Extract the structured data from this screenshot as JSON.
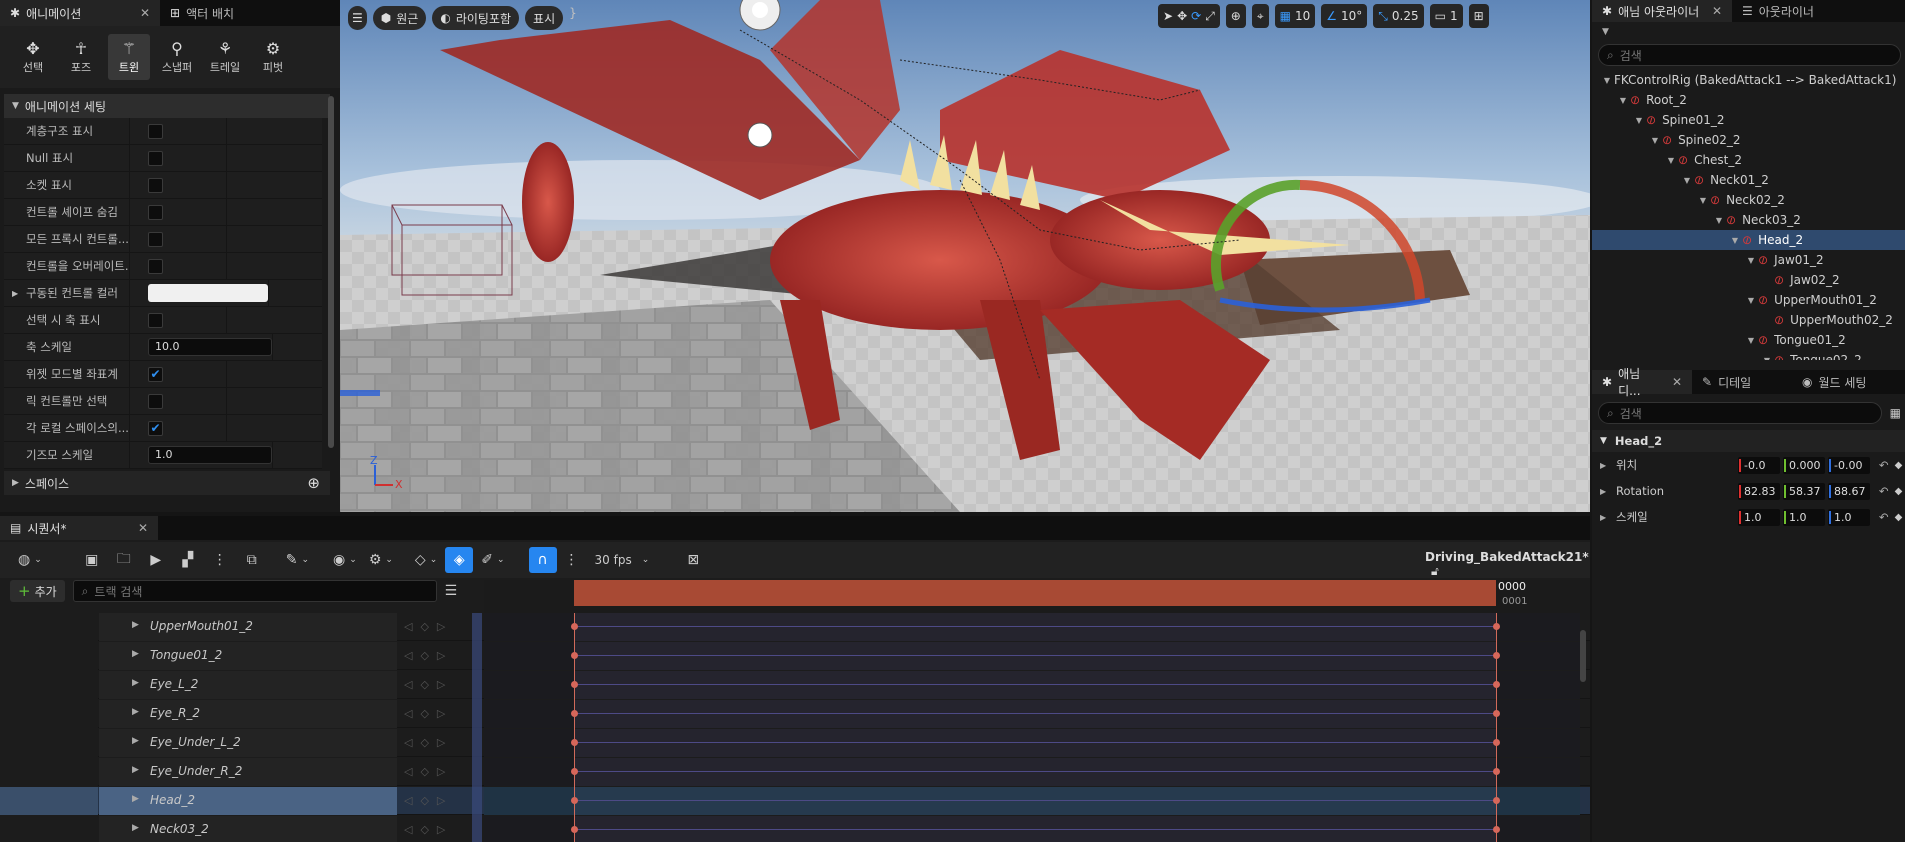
{
  "left_panel": {
    "tabs": [
      {
        "label": "애니메이션",
        "active": true
      },
      {
        "label": "액터 배치",
        "active": false
      }
    ],
    "modes": [
      {
        "label": "선택",
        "icon": "select-icon"
      },
      {
        "label": "포즈",
        "icon": "pose-icon"
      },
      {
        "label": "트윈",
        "icon": "tween-icon",
        "selected": true
      },
      {
        "label": "스냅퍼",
        "icon": "snapper-icon"
      },
      {
        "label": "트레일",
        "icon": "trail-icon"
      },
      {
        "label": "피벗",
        "icon": "pivot-icon"
      }
    ],
    "section_title": "애니메이션 세팅",
    "rows": [
      {
        "label": "계층구조 표시",
        "type": "checkbox",
        "checked": false
      },
      {
        "label": "Null 표시",
        "type": "checkbox",
        "checked": false
      },
      {
        "label": "소켓 표시",
        "type": "checkbox",
        "checked": false
      },
      {
        "label": "컨트롤 셰이프 숨김",
        "type": "checkbox",
        "checked": false
      },
      {
        "label": "모든 프록시 컨트롤...",
        "type": "checkbox",
        "checked": false
      },
      {
        "label": "컨트롤을 오버레이트...",
        "type": "checkbox",
        "checked": false
      },
      {
        "label": "구동된 컨트롤 컬러",
        "type": "color",
        "expandable": true
      },
      {
        "label": "선택 시 축 표시",
        "type": "checkbox",
        "checked": false
      },
      {
        "label": "축 스케일",
        "type": "number",
        "value": "10.0"
      },
      {
        "label": "위젯 모드별 좌표계",
        "type": "checkbox",
        "checked": true
      },
      {
        "label": "릭 컨트롤만 선택",
        "type": "checkbox",
        "checked": false
      },
      {
        "label": "각 로컬 스페이스의...",
        "type": "checkbox",
        "checked": true
      },
      {
        "label": "기즈모 스케일",
        "type": "number",
        "value": "1.0"
      }
    ],
    "space_section": "스페이스"
  },
  "viewport": {
    "view_mode": "원근",
    "lighting": "라이팅포함",
    "show": "표시",
    "grid_snap": "10",
    "rot_snap": "10°",
    "scale_snap": "0.25",
    "camera_speed": "1"
  },
  "outliner": {
    "tabs": [
      {
        "label": "애님 아웃라이너",
        "active": true
      },
      {
        "label": "아웃라이너",
        "active": false
      }
    ],
    "search_placeholder": "검색",
    "root": "FKControlRig  (BakedAttack1 --> BakedAttack1)",
    "nodes": [
      {
        "label": "Root_2",
        "depth": 1
      },
      {
        "label": "Spine01_2",
        "depth": 2
      },
      {
        "label": "Spine02_2",
        "depth": 3
      },
      {
        "label": "Chest_2",
        "depth": 4
      },
      {
        "label": "Neck01_2",
        "depth": 5
      },
      {
        "label": "Neck02_2",
        "depth": 6
      },
      {
        "label": "Neck03_2",
        "depth": 7
      },
      {
        "label": "Head_2",
        "depth": 8,
        "selected": true
      },
      {
        "label": "Jaw01_2",
        "depth": 9
      },
      {
        "label": "Jaw02_2",
        "depth": 10
      },
      {
        "label": "UpperMouth01_2",
        "depth": 9
      },
      {
        "label": "UpperMouth02_2",
        "depth": 10
      },
      {
        "label": "Tongue01_2",
        "depth": 9
      },
      {
        "label": "Tongue02_2",
        "depth": 10
      }
    ]
  },
  "details": {
    "tabs": [
      {
        "label": "애님 디...",
        "active": true
      },
      {
        "label": "디테일",
        "active": false
      },
      {
        "label": "월드 세팅",
        "active": false
      }
    ],
    "search_placeholder": "검색",
    "section": "Head_2",
    "rows": [
      {
        "label": "위치",
        "x": "-0.0",
        "y": "0.000",
        "z": "-0.00"
      },
      {
        "label": "Rotation",
        "x": "82.83",
        "y": "58.37",
        "z": "88.67"
      },
      {
        "label": "스케일",
        "x": "1.0",
        "y": "1.0",
        "z": "1.0"
      }
    ]
  },
  "sequencer": {
    "tab": "시퀀서*",
    "fps": "30 fps",
    "sequence_name": "Driving_BakedAttack21*",
    "add_label": "추가",
    "search_placeholder": "트랙 검색",
    "frame_top": "0000",
    "frame_bottom": "0001",
    "tracks": [
      {
        "name": "UpperMouth01_2"
      },
      {
        "name": "Tongue01_2"
      },
      {
        "name": "Eye_L_2"
      },
      {
        "name": "Eye_R_2"
      },
      {
        "name": "Eye_Under_L_2"
      },
      {
        "name": "Eye_Under_R_2"
      },
      {
        "name": "Head_2",
        "selected": true
      },
      {
        "name": "Neck03_2"
      }
    ]
  }
}
